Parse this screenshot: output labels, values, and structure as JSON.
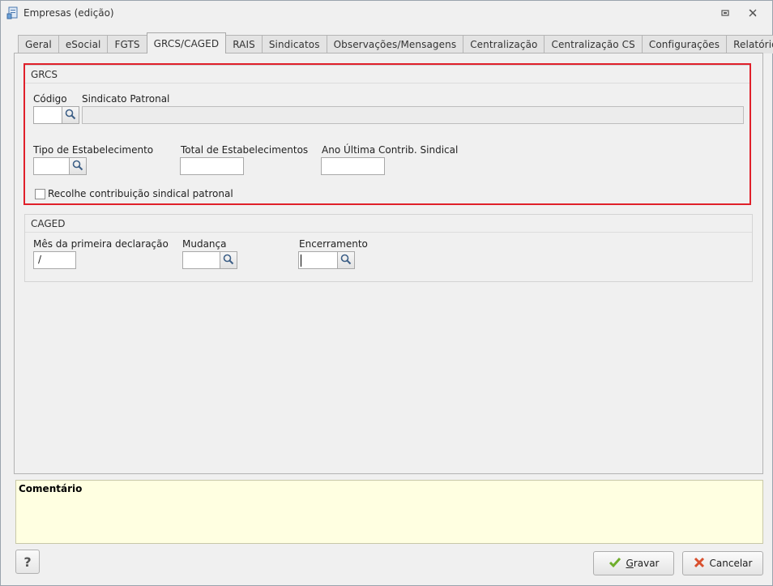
{
  "window": {
    "title": "Empresas (edição)"
  },
  "tabs": [
    {
      "label": "Geral"
    },
    {
      "label": "eSocial"
    },
    {
      "label": "FGTS"
    },
    {
      "label": "GRCS/CAGED",
      "active": true
    },
    {
      "label": "RAIS"
    },
    {
      "label": "Sindicatos"
    },
    {
      "label": "Observações/Mensagens"
    },
    {
      "label": "Centralização"
    },
    {
      "label": "Centralização CS"
    },
    {
      "label": "Configurações"
    },
    {
      "label": "Relatórios"
    }
  ],
  "grcs": {
    "title": "GRCS",
    "codigo_label": "Código",
    "codigo_value": "",
    "sindicato_label": "Sindicato Patronal",
    "sindicato_value": "",
    "tipo_label": "Tipo de Estabelecimento",
    "tipo_value": "",
    "total_label": "Total de Estabelecimentos",
    "total_value": "",
    "ano_label": "Ano Última Contrib. Sindical",
    "ano_value": "",
    "recolhe_label": "Recolhe contribuição sindical patronal",
    "recolhe_checked": false
  },
  "caged": {
    "title": "CAGED",
    "mes_label": "Mês da primeira declaração",
    "mes_value": "/",
    "mudanca_label": "Mudança",
    "mudanca_value": "",
    "encerramento_label": "Encerramento",
    "encerramento_value": ""
  },
  "comment": {
    "label": "Comentário"
  },
  "footer": {
    "help_label": "?",
    "save_label": "Gravar",
    "cancel_label": "Cancelar"
  },
  "colors": {
    "highlight": "#e0202a",
    "comment_bg": "#ffffe1",
    "save_icon": "#6fae2c",
    "cancel_icon": "#d9502e"
  }
}
